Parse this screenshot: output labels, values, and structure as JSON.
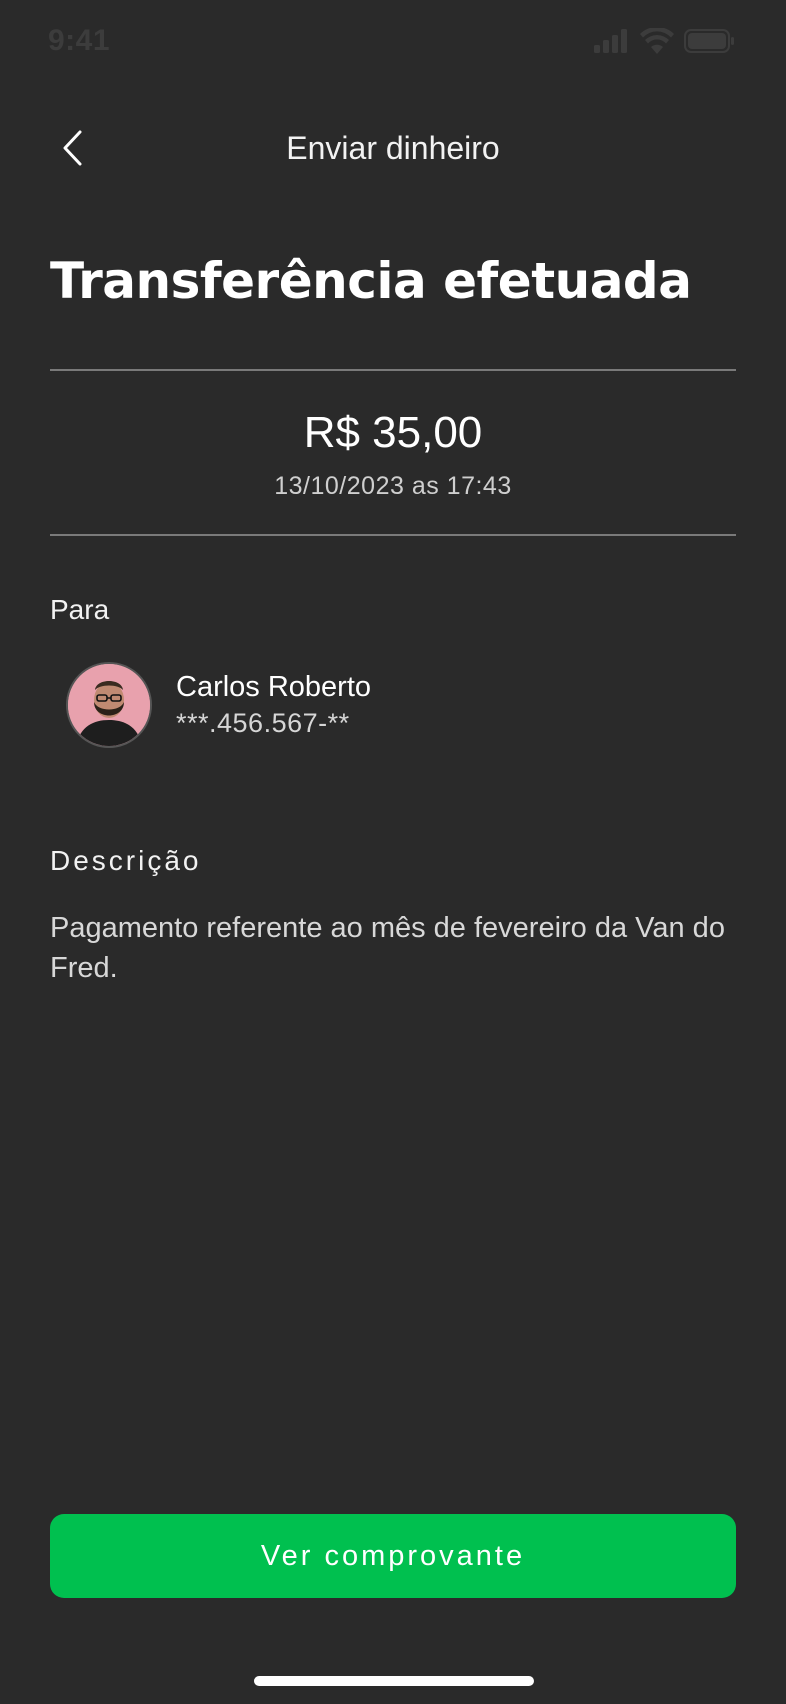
{
  "status_bar": {
    "time": "9:41"
  },
  "header": {
    "title": "Enviar dinheiro"
  },
  "main": {
    "heading": "Transferência efetuada",
    "amount": "R$ 35,00",
    "datetime": "13/10/2023 as 17:43",
    "recipient_label": "Para",
    "recipient": {
      "name": "Carlos Roberto",
      "document": "***.456.567-**"
    },
    "description_label": "Descrição",
    "description_text": "Pagamento referente ao mês de fevereiro da Van do Fred."
  },
  "actions": {
    "primary_label": "Ver comprovante"
  },
  "colors": {
    "background": "#2a2a2a",
    "accent": "#00c04f"
  },
  "icons": {
    "back": "chevron-left-icon",
    "signal": "signal-icon",
    "wifi": "wifi-icon",
    "battery": "battery-icon"
  }
}
